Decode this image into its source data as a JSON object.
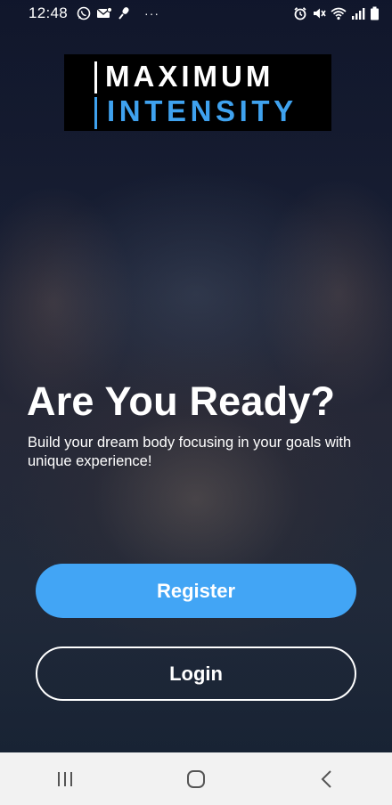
{
  "status_bar": {
    "time": "12:48",
    "more_indicator": "···",
    "left_icons": [
      "whatsapp-icon",
      "message-icon",
      "mic-icon"
    ],
    "right_icons": [
      "alarm-icon",
      "mute-icon",
      "wifi-icon",
      "signal-icon",
      "battery-icon"
    ]
  },
  "logo": {
    "line1": "MAXIMUM",
    "line2": "INTENSITY",
    "accent_color": "#3fa2ef"
  },
  "hero": {
    "title": "Are You Ready?",
    "subtitle": "Build your dream body focusing in your goals with unique experience!"
  },
  "actions": {
    "register_label": "Register",
    "login_label": "Login",
    "register_color": "#42a5f5"
  },
  "nav_bar": {
    "buttons": [
      "recent-apps-icon",
      "home-icon",
      "back-icon"
    ]
  }
}
